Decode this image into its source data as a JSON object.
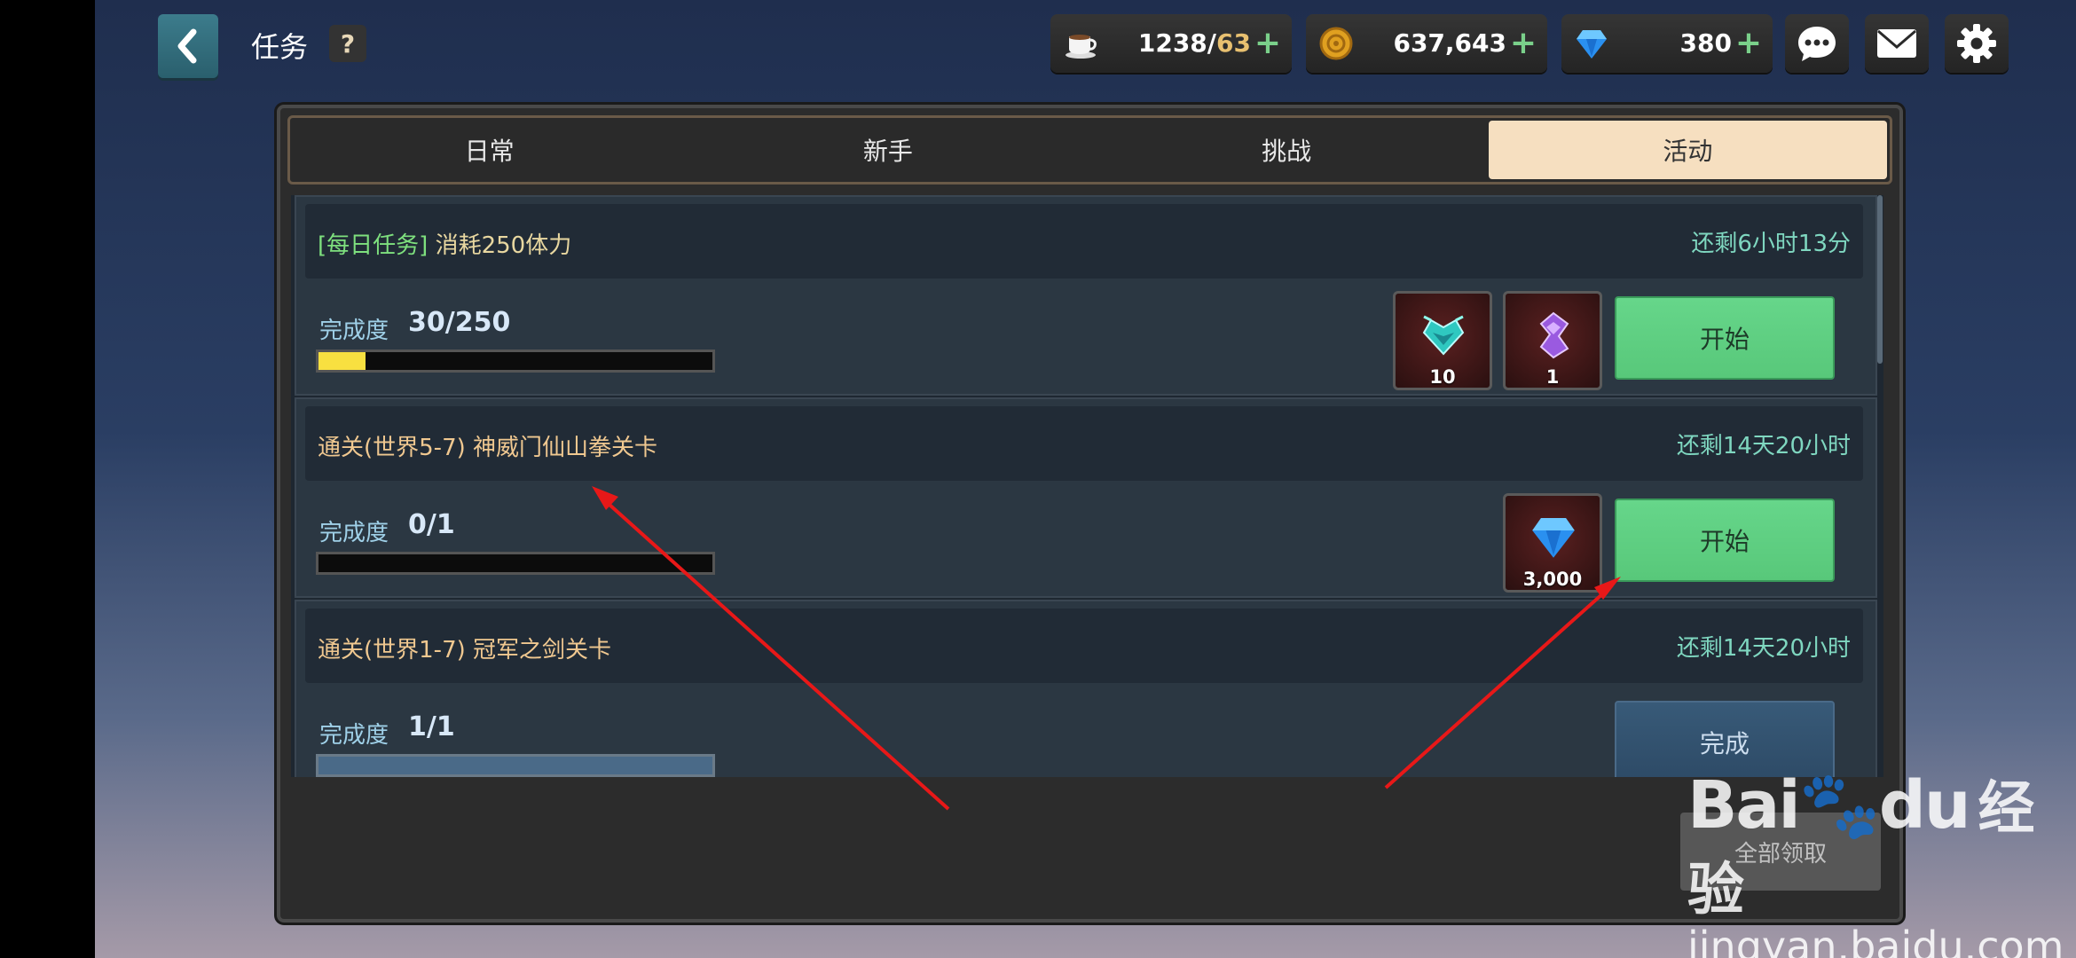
{
  "header": {
    "title": "任务",
    "help_label": "?",
    "stamina": {
      "current": "1238",
      "sep": "/",
      "max": "63"
    },
    "gold": "637,643",
    "gems": "380",
    "plus": "+"
  },
  "tabs": [
    {
      "label": "日常",
      "active": false
    },
    {
      "label": "新手",
      "active": false
    },
    {
      "label": "挑战",
      "active": false
    },
    {
      "label": "活动",
      "active": true
    }
  ],
  "quests": [
    {
      "tag": "[每日任务]",
      "name": "消耗250体力",
      "time_left": "还剩6小时13分",
      "progress_label": "完成度",
      "progress_text": "30/250",
      "progress": 0.12,
      "rewards": [
        {
          "icon": "crystal-heart-icon",
          "amount": "10"
        },
        {
          "icon": "purple-crystal-icon",
          "amount": "1"
        }
      ],
      "button": "开始"
    },
    {
      "name": "通关(世界5-7) 神威门仙山拳关卡",
      "time_left": "还剩14天20小时",
      "progress_label": "完成度",
      "progress_text": "0/1",
      "progress": 0,
      "rewards": [
        {
          "icon": "diamond-icon",
          "amount": "3,000"
        }
      ],
      "button": "开始"
    },
    {
      "name": "通关(世界1-7) 冠军之剑关卡",
      "time_left": "还剩14天20小时",
      "progress_label": "完成度",
      "progress_text": "1/1",
      "progress": 1,
      "button": "完成"
    }
  ],
  "footer": {
    "claim_all": "全部领取"
  },
  "watermark": {
    "logo": "Bai",
    "logo2": "du",
    "cn": "经验",
    "url": "jingyan.baidu.com"
  },
  "colors": {
    "accent_green": "#66d68a",
    "arrow_red": "#e81818",
    "active_tab": "#f6dfc0"
  }
}
